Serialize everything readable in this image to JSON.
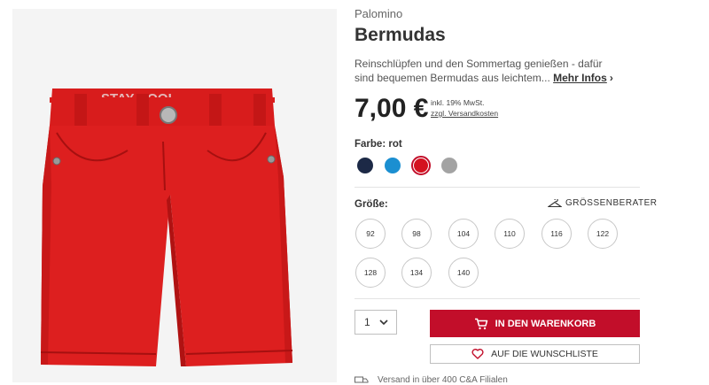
{
  "product": {
    "brand": "Palomino",
    "title": "Bermudas",
    "description": "Reinschlüpfen und den Sommertag genießen - dafür sind bequemen Bermudas aus leichtem...",
    "more_link": "Mehr Infos",
    "price": "7,00 €",
    "vat_note": "inkl. 19% MwSt.",
    "shipping_costs_link": "zzgl. Versandkosten",
    "waistband_print": "STAY COOL"
  },
  "colors": {
    "label": "Farbe: rot",
    "swatches": [
      {
        "name": "navy",
        "hex": "#1c2946"
      },
      {
        "name": "blue",
        "hex": "#1b8fd1"
      },
      {
        "name": "red",
        "hex": "#d4121f",
        "selected": true
      },
      {
        "name": "grey",
        "hex": "#a3a3a3"
      }
    ],
    "accent": "#c20e2a"
  },
  "sizes": {
    "label": "Größe:",
    "advisor": "GRÖSSENBERATER",
    "options": [
      "92",
      "98",
      "104",
      "110",
      "116",
      "122",
      "128",
      "134",
      "140"
    ]
  },
  "purchase": {
    "quantity": "1",
    "add_to_cart": "IN DEN WARENKORB",
    "add_to_wishlist": "AUF DIE WUNSCHLISTE"
  },
  "delivery": {
    "note": "Versand in über 400 C&A Filialen"
  }
}
